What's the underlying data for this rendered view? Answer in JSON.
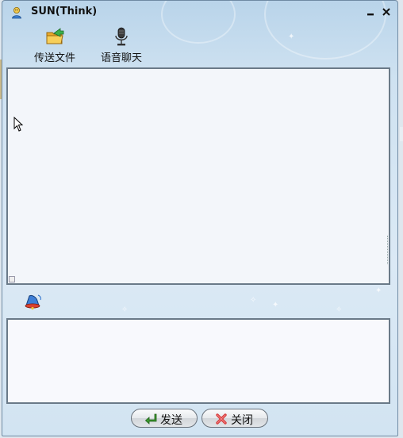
{
  "window": {
    "title": "SUN(Think)",
    "title_icon": "user-avatar-icon",
    "minimize_icon": "minimize-icon",
    "close_icon": "close-icon"
  },
  "toolbar": {
    "items": [
      {
        "label": "传送文件",
        "icon": "folder-send-icon"
      },
      {
        "label": "语音聊天",
        "icon": "microphone-icon"
      }
    ]
  },
  "chat_history": {
    "messages": []
  },
  "input_area": {
    "value": "",
    "format_icon": "font-bell-icon"
  },
  "buttons": {
    "send_label": "发送",
    "close_label": "关闭"
  },
  "colors": {
    "window_bg": "#cfe2f1",
    "panel_border": "#6a7a88",
    "panel_bg": "#f3f6fa",
    "send_arrow": "#3c9a2f",
    "close_x": "#d83a3a"
  }
}
